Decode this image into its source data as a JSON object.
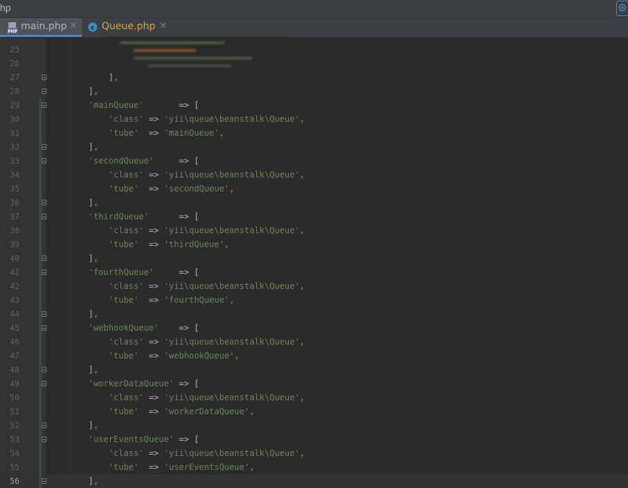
{
  "window": {
    "title_fragment": "hp"
  },
  "tabs": [
    {
      "label": "main.php",
      "icon": "php-file-icon",
      "active": true
    },
    {
      "label": "Queue.php",
      "icon": "class-icon",
      "active": false
    }
  ],
  "colors": {
    "background": "#2b2b2b",
    "gutter": "#313335",
    "string": "#6a8759",
    "punctuation": "#cc7832",
    "text": "#a9b7c6",
    "line_number": "#606366",
    "vcs_added": "#384c38",
    "accent": "#4a88c7"
  },
  "editor": {
    "current_line": "56",
    "lines": [
      {
        "num": "25",
        "text": ""
      },
      {
        "num": "26",
        "text": ""
      },
      {
        "num": "27",
        "text": "    ],"
      },
      {
        "num": "28",
        "text": "],"
      },
      {
        "num": "29",
        "text": "'mainQueue'       => ["
      },
      {
        "num": "30",
        "text": "    'class' => 'yii\\queue\\beanstalk\\Queue',"
      },
      {
        "num": "31",
        "text": "    'tube'  => 'mainQueue',"
      },
      {
        "num": "32",
        "text": "],"
      },
      {
        "num": "33",
        "text": "'secondQueue'     => ["
      },
      {
        "num": "34",
        "text": "    'class' => 'yii\\queue\\beanstalk\\Queue',"
      },
      {
        "num": "35",
        "text": "    'tube'  => 'secondQueue',"
      },
      {
        "num": "36",
        "text": "],"
      },
      {
        "num": "37",
        "text": "'thirdQueue'      => ["
      },
      {
        "num": "38",
        "text": "    'class' => 'yii\\queue\\beanstalk\\Queue',"
      },
      {
        "num": "39",
        "text": "    'tube'  => 'thirdQueue',"
      },
      {
        "num": "40",
        "text": "],"
      },
      {
        "num": "41",
        "text": "'fourthQueue'     => ["
      },
      {
        "num": "42",
        "text": "    'class' => 'yii\\queue\\beanstalk\\Queue',"
      },
      {
        "num": "43",
        "text": "    'tube'  => 'fourthQueue',"
      },
      {
        "num": "44",
        "text": "],"
      },
      {
        "num": "45",
        "text": "'webhookQueue'    => ["
      },
      {
        "num": "46",
        "text": "    'class' => 'yii\\queue\\beanstalk\\Queue',"
      },
      {
        "num": "47",
        "text": "    'tube'  => 'webhookQueue',"
      },
      {
        "num": "48",
        "text": "],"
      },
      {
        "num": "49",
        "text": "'workerDataQueue' => ["
      },
      {
        "num": "50",
        "text": "    'class' => 'yii\\queue\\beanstalk\\Queue',"
      },
      {
        "num": "51",
        "text": "    'tube'  => 'workerDataQueue',"
      },
      {
        "num": "52",
        "text": "],"
      },
      {
        "num": "53",
        "text": "'userEventsQueue' => ["
      },
      {
        "num": "54",
        "text": "    'class' => 'yii\\queue\\beanstalk\\Queue',"
      },
      {
        "num": "55",
        "text": "    'tube'  => 'userEventsQueue',"
      },
      {
        "num": "56",
        "text": "],"
      }
    ]
  }
}
